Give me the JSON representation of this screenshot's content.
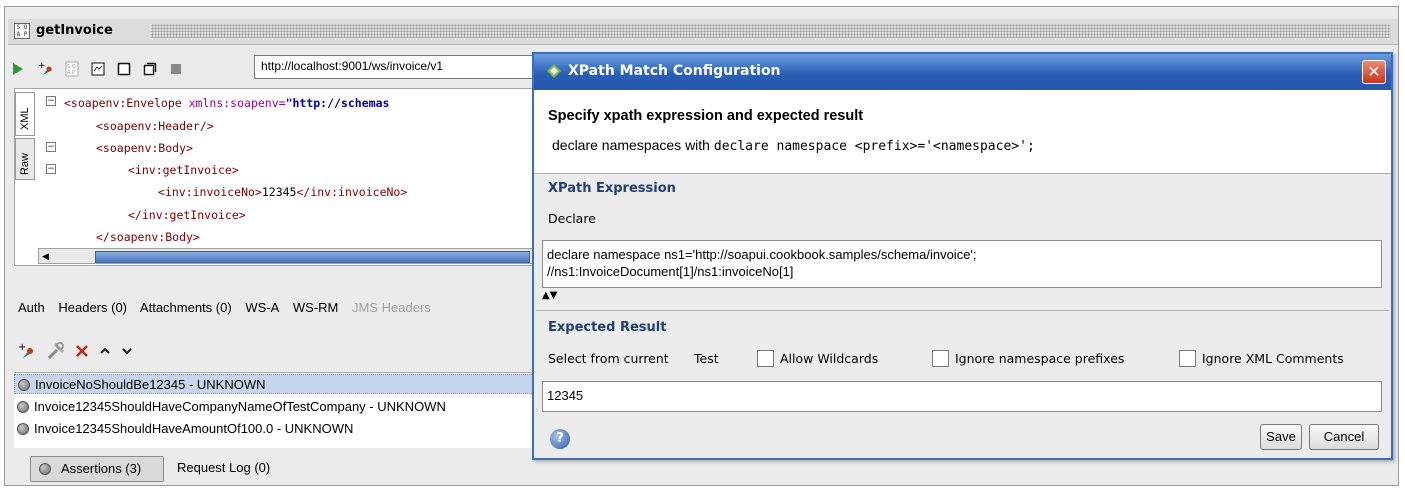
{
  "window": {
    "title": "getInvoice"
  },
  "toolbar": {
    "endpoint_url": "http://localhost:9001/ws/invoice/v1"
  },
  "editor": {
    "tabs": [
      "XML",
      "Raw"
    ],
    "lines": [
      {
        "tag_open": "<soapenv:Envelope",
        "attr": " xmlns:soapenv=",
        "value": "\"http://schemas"
      },
      {
        "text": "<soapenv:Header/>"
      },
      {
        "text": "<soapenv:Body>"
      },
      {
        "text": "<inv:getInvoice>"
      },
      {
        "pre": "<inv:invoiceNo>",
        "val": "12345",
        "post": "</inv:invoiceNo>"
      },
      {
        "text": "</inv:getInvoice>"
      },
      {
        "text": "</soapenv:Body>"
      }
    ]
  },
  "request_tabs": {
    "auth": "Auth",
    "headers": "Headers (0)",
    "attachments": "Attachments (0)",
    "wsa": "WS-A",
    "wsrm": "WS-RM",
    "jms": "JMS Headers"
  },
  "assertions": {
    "items": [
      "InvoiceNoShouldBe12345 - UNKNOWN",
      "Invoice12345ShouldHaveCompanyNameOfTestCompany - UNKNOWN",
      "Invoice12345ShouldHaveAmountOf100.0 - UNKNOWN"
    ],
    "tab_label": "Assertions (3)",
    "request_log_label": "Request Log (0)"
  },
  "dialog": {
    "title": "XPath Match Configuration",
    "heading": "Specify xpath expression and expected result",
    "subheading_prefix": "declare namespaces with ",
    "subheading_code": "declare namespace <prefix>='<namespace>';",
    "xpath_section": "XPath Expression",
    "declare_label": "Declare",
    "xpath_line1": "declare namespace ns1='http://soapui.cookbook.samples/schema/invoice';",
    "xpath_line2": "//ns1:InvoiceDocument[1]/ns1:invoiceNo[1]",
    "expected_section": "Expected Result",
    "select_from_current": "Select from current",
    "test_label": "Test",
    "allow_wildcards": "Allow Wildcards",
    "ignore_ns_prefixes": "Ignore namespace prefixes",
    "ignore_xml_comments": "Ignore XML Comments",
    "expected_value": "12345",
    "save_label": "Save",
    "cancel_label": "Cancel"
  },
  "colors": {
    "dialog_title_bg": "#2b5fb6",
    "section_header": "#20407a",
    "selection": "#c5d6ee"
  }
}
